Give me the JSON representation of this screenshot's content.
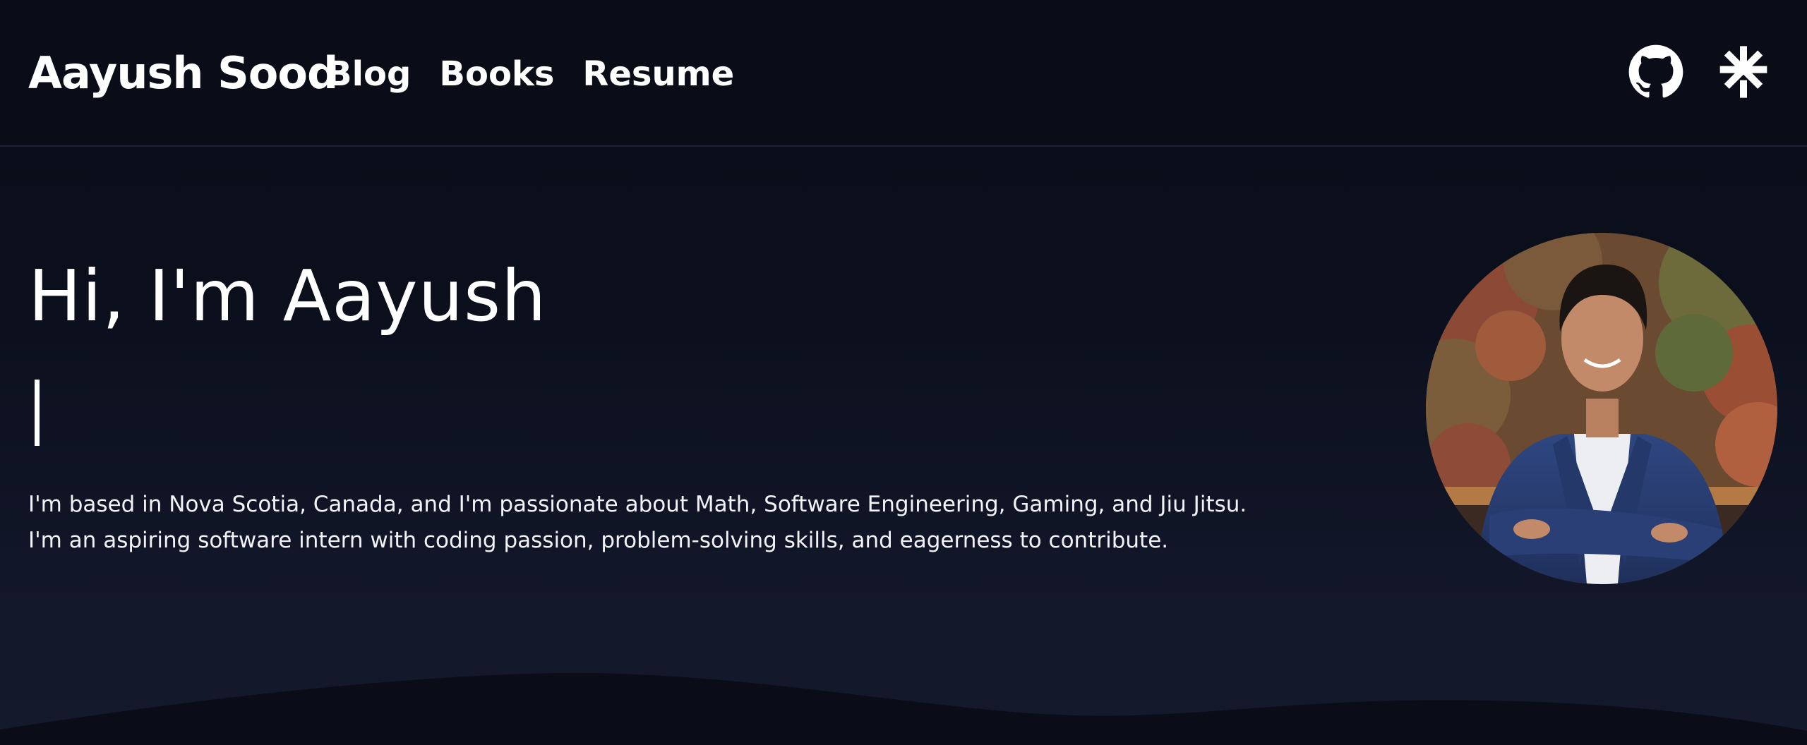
{
  "header": {
    "brand": "Aayush Sood",
    "nav": [
      {
        "label": "Blog"
      },
      {
        "label": "Books"
      },
      {
        "label": "Resume"
      }
    ],
    "social": [
      {
        "icon": "github-icon"
      },
      {
        "icon": "linktree-icon"
      }
    ]
  },
  "hero": {
    "title": "Hi, I'm Aayush",
    "typed_text": "",
    "bio": [
      "I'm based in Nova Scotia, Canada, and I'm passionate about Math, Software Engineering, Gaming, and Jiu Jitsu.",
      "I'm an aspiring software intern with coding passion, problem-solving skills, and eagerness to contribute."
    ]
  },
  "colors": {
    "background": "#0a0e18",
    "text": "#ffffff",
    "wave": "#0a0d17"
  }
}
